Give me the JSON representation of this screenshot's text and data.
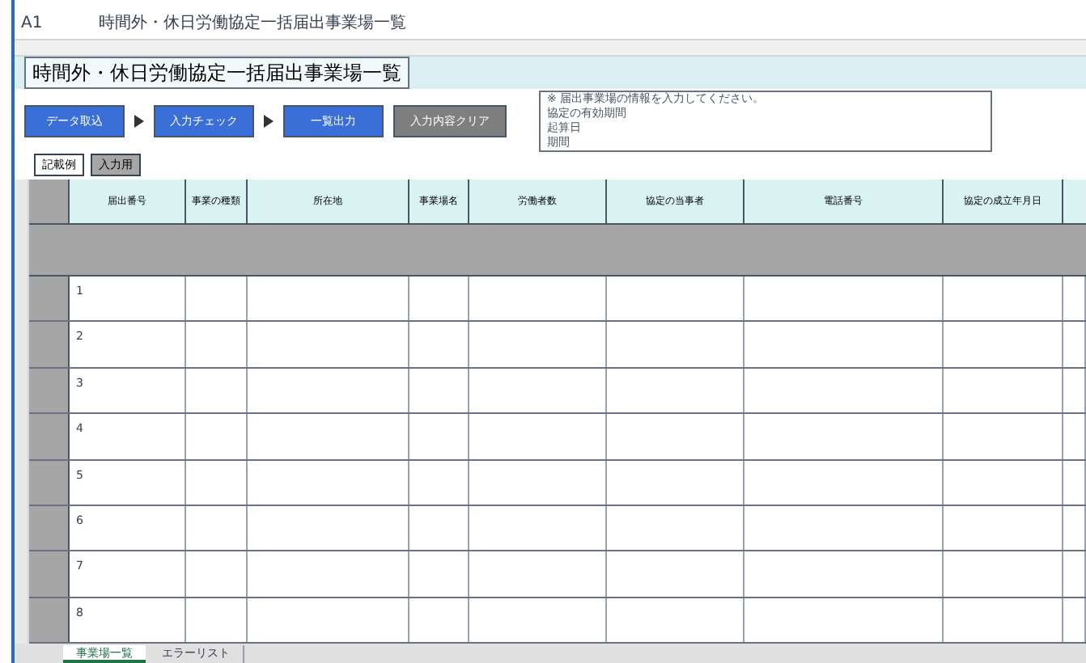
{
  "formula_bar": {
    "cell": "A1",
    "formula": "時間外・休日労働協定一括届出事業場一覧"
  },
  "title": "時間外・休日労働協定一括届出事業場一覧",
  "buttons": [
    {
      "label": "データ取込",
      "kind": "step"
    },
    {
      "label": "入力チェック",
      "kind": "step"
    },
    {
      "label": "一覧出力",
      "kind": "step"
    },
    {
      "label": "入力内容クリア",
      "kind": "clear"
    }
  ],
  "note_lines": [
    "※ 届出事業場の情報を入力してください。",
    "協定の有効期間",
    "起算日",
    "期間"
  ],
  "sheet_buttons": [
    {
      "label": "記載例",
      "selected": true
    },
    {
      "label": "入力用",
      "selected": false
    }
  ],
  "columns": [
    "届出番号",
    "事業の種類",
    "所在地",
    "事業場名",
    "労働者数",
    "協定の当事者",
    "電話番号",
    "協定の成立年月日"
  ],
  "rows": [
    "1",
    "2",
    "3",
    "4",
    "5",
    "6",
    "7",
    "8"
  ],
  "sheet_tabs": [
    {
      "label": "事業場一覧",
      "selected": true
    },
    {
      "label": "エラーリスト",
      "selected": false
    }
  ]
}
